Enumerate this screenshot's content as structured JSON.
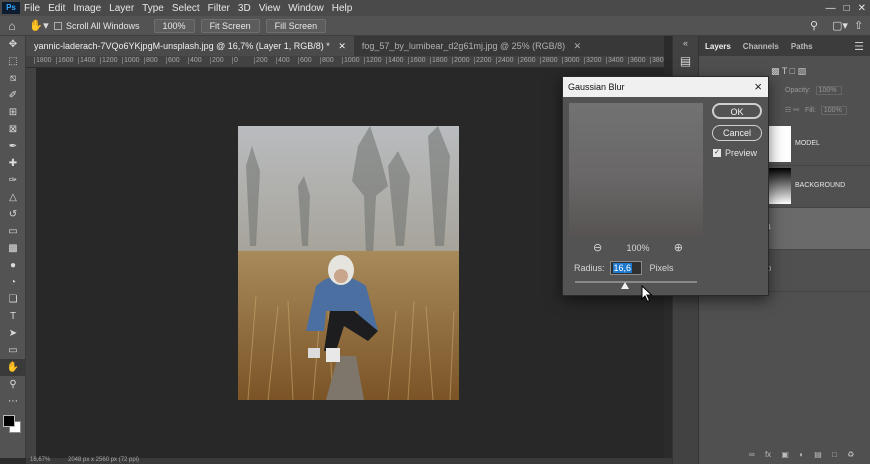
{
  "menubar": {
    "logo": "Ps",
    "items": [
      "File",
      "Edit",
      "Image",
      "Layer",
      "Type",
      "Select",
      "Filter",
      "3D",
      "View",
      "Window",
      "Help"
    ]
  },
  "options": {
    "scroll_all_windows": "Scroll All Windows",
    "zoom_value": "100%",
    "fit_screen": "Fit Screen",
    "fill_screen": "Fill Screen"
  },
  "tabs": [
    {
      "label": "yannic-laderach-7VQo6YKjpgM-unsplash.jpg @ 16,7% (Layer 1, RGB/8) *"
    },
    {
      "label": "fog_57_by_lumibear_d2g61mj.jpg @ 25% (RGB/8)"
    }
  ],
  "ruler": {
    "ticks": [
      "1800",
      "1600",
      "1400",
      "1200",
      "1000",
      "800",
      "600",
      "400",
      "200",
      "0",
      "200",
      "400",
      "600",
      "800",
      "1000",
      "1200",
      "1400",
      "1600",
      "1800",
      "2000",
      "2200",
      "2400",
      "2600",
      "2800",
      "3000",
      "3200",
      "3400",
      "3600",
      "3800"
    ]
  },
  "status": {
    "zoom": "16,67%",
    "doc_size": "2048 px x 2560 px (72 ppi)"
  },
  "layers_panel": {
    "tabs": [
      "Layers",
      "Channels",
      "Paths"
    ],
    "opacity_label": "Opacity:",
    "opacity_value": "100%",
    "fill_label": "Fill:",
    "fill_value": "100%",
    "layers": [
      {
        "name": "MODEL"
      },
      {
        "name": "BACKGROUND"
      },
      {
        "name": "r 1"
      },
      {
        "name": "r 0"
      }
    ]
  },
  "dialog": {
    "title": "Gaussian Blur",
    "ok": "OK",
    "cancel": "Cancel",
    "preview": "Preview",
    "zoom": "100%",
    "radius_label": "Radius:",
    "radius_value": "16,6",
    "units": "Pixels"
  },
  "colors": {
    "accent": "#1e78d0",
    "menubar_bg": "#4a4a4a",
    "canvas_bg": "#282828",
    "panel_bg": "#505050"
  }
}
